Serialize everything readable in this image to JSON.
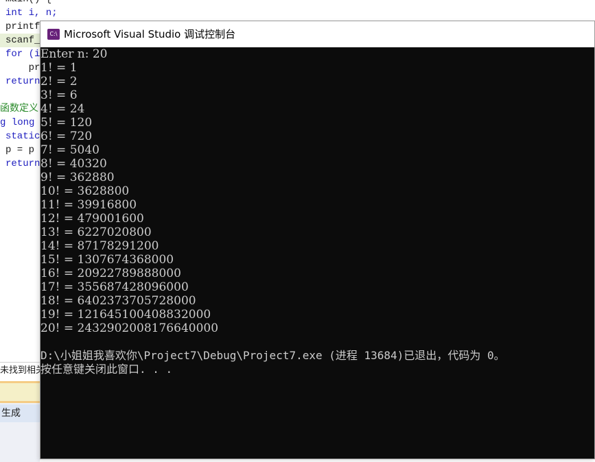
{
  "editor": {
    "lines": [
      "main() {",
      "int i, n;",
      "printf",
      "scanf_",
      "for (i",
      "    pr",
      "return",
      "",
      "函数定义",
      "g long ",
      "static",
      "p = p ",
      "return"
    ]
  },
  "ide": {
    "find_label": "未找到相关",
    "build_label": "生成"
  },
  "console": {
    "title": "Microsoft Visual Studio 调试控制台",
    "icon_text": "C:\\",
    "lines": [
      "Enter n: 20",
      "1! = 1",
      "2! = 2",
      "3! = 6",
      "4! = 24",
      "5! = 120",
      "6! = 720",
      "7! = 5040",
      "8! = 40320",
      "9! = 362880",
      "10! = 3628800",
      "11! = 39916800",
      "12! = 479001600",
      "13! = 6227020800",
      "14! = 87178291200",
      "15! = 1307674368000",
      "16! = 20922789888000",
      "17! = 355687428096000",
      "18! = 6402373705728000",
      "19! = 121645100408832000",
      "20! = 2432902008176640000",
      "",
      "D:\\小姐姐我喜欢你\\Project7\\Debug\\Project7.exe (进程 13684)已退出，代码为 0。",
      "按任意键关闭此窗口. . ."
    ]
  }
}
